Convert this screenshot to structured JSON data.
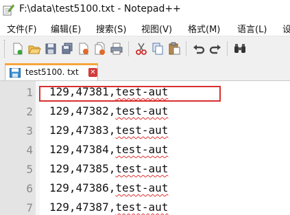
{
  "window": {
    "title": "F:\\data\\test5100.txt - Notepad++"
  },
  "menu": [
    "文件(F)",
    "编辑(E)",
    "搜索(S)",
    "视图(V)",
    "格式(M)",
    "语言(L)",
    "设"
  ],
  "toolbar": {
    "icons": [
      "new-file-icon",
      "open-file-icon",
      "save-icon",
      "save-all-icon",
      "close-icon",
      "close-all-icon",
      "print-icon",
      "cut-icon",
      "copy-icon",
      "paste-icon",
      "undo-icon",
      "redo-icon",
      "find-icon"
    ]
  },
  "tab": {
    "label": "test5100. txt",
    "close_glyph": "✕"
  },
  "editor": {
    "lines": [
      {
        "number": "1",
        "prefix": "129,47381,",
        "suffix": "test-aut"
      },
      {
        "number": "2",
        "prefix": "129,47382,",
        "suffix": "test-aut"
      },
      {
        "number": "3",
        "prefix": "129,47383,",
        "suffix": "test-aut"
      },
      {
        "number": "4",
        "prefix": "129,47384,",
        "suffix": "test-aut"
      },
      {
        "number": "5",
        "prefix": "129,47385,",
        "suffix": "test-aut"
      },
      {
        "number": "6",
        "prefix": "129,47386,",
        "suffix": "test-aut"
      },
      {
        "number": "7",
        "prefix": "129,47387,",
        "suffix": "test-aut"
      }
    ]
  },
  "colors": {
    "highlight": "#d7302e",
    "tab_accent": "#f6a53c",
    "close": "#d23b3b"
  }
}
